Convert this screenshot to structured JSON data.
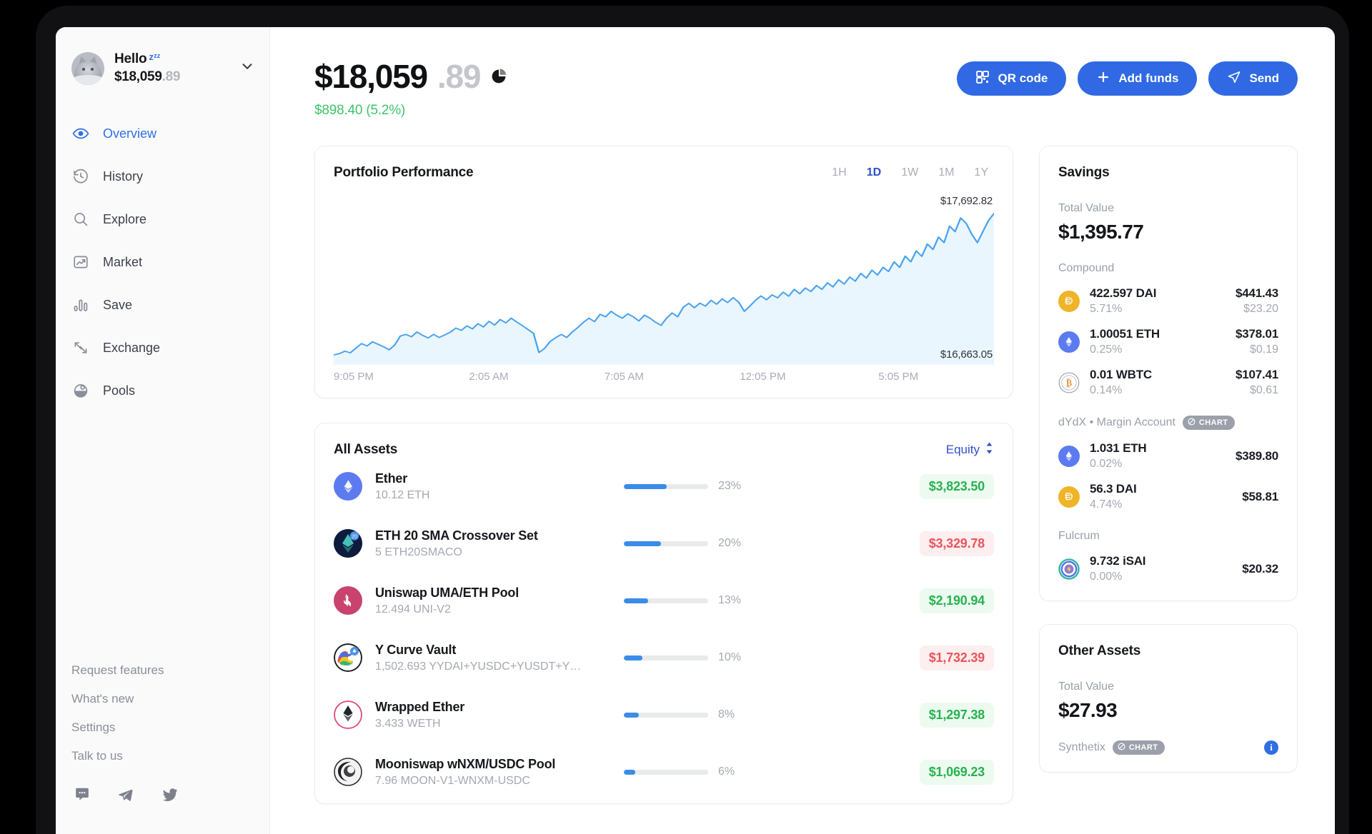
{
  "sidebar": {
    "greeting": "Hello",
    "sleep_emoji": "zᶻᶻ",
    "balance_main": "$18,059",
    "balance_cents": ".89",
    "nav": [
      {
        "label": "Overview",
        "icon": "eye-icon",
        "active": true
      },
      {
        "label": "History",
        "icon": "history-clock-icon",
        "active": false
      },
      {
        "label": "Explore",
        "icon": "search-icon",
        "active": false
      },
      {
        "label": "Market",
        "icon": "market-trend-icon",
        "active": false
      },
      {
        "label": "Save",
        "icon": "bar-chart-icon",
        "active": false
      },
      {
        "label": "Exchange",
        "icon": "exchange-arrows-icon",
        "active": false
      },
      {
        "label": "Pools",
        "icon": "pools-pie-icon",
        "active": false
      }
    ],
    "links": [
      "Request features",
      "What's new",
      "Settings",
      "Talk to us"
    ],
    "socials": [
      "discord-icon",
      "telegram-icon",
      "twitter-icon"
    ]
  },
  "header": {
    "balance_main": "$18,059",
    "balance_cents": ".89",
    "pie_icon": "pie-chart-icon",
    "change": "$898.40 (5.2%)",
    "change_color": "#3dc46a",
    "buttons": [
      {
        "label": "QR code",
        "icon": "qr-code-icon"
      },
      {
        "label": "Add funds",
        "icon": "plus-icon"
      },
      {
        "label": "Send",
        "icon": "send-paper-plane-icon"
      }
    ]
  },
  "chart_data": {
    "type": "area",
    "title": "Portfolio Performance",
    "xlabel": "",
    "ylabel": "",
    "ranges": [
      "1H",
      "1D",
      "1W",
      "1M",
      "1Y"
    ],
    "active_range": "1D",
    "high_label": "$17,692.82",
    "low_label": "$16,663.05",
    "ylim": [
      16663.05,
      17692.82
    ],
    "grid": false,
    "legend": "none",
    "line_color": "#4ba3ef",
    "fill_color": "#eaf5fd",
    "x_ticks": [
      "9:05 PM",
      "2:05 AM",
      "7:05 AM",
      "12:05 PM",
      "5:05 PM"
    ],
    "x": [
      0,
      1,
      2,
      3,
      4,
      5,
      6,
      7,
      8,
      9,
      10,
      11,
      12,
      13,
      14,
      15,
      16,
      17,
      18,
      19,
      20,
      21,
      22,
      23,
      24,
      25,
      26,
      27,
      28,
      29,
      30,
      31,
      32,
      33,
      34,
      35,
      36,
      37,
      38,
      39,
      40,
      41,
      42,
      43,
      44,
      45,
      46,
      47,
      48,
      49,
      50,
      51,
      52,
      53,
      54,
      55,
      56,
      57,
      58,
      59,
      60,
      61,
      62,
      63,
      64,
      65,
      66,
      67,
      68,
      69,
      70,
      71,
      72,
      73,
      74,
      75,
      76,
      77,
      78,
      79,
      80,
      81,
      82,
      83,
      84,
      85,
      86,
      87,
      88,
      89,
      90,
      91,
      92,
      93,
      94,
      95,
      96,
      97,
      98,
      99,
      100,
      101,
      102,
      103,
      104,
      105,
      106,
      107,
      108,
      109,
      110,
      111,
      112,
      113,
      114,
      115,
      116,
      117,
      118,
      119
    ],
    "values": [
      16663,
      16672,
      16690,
      16678,
      16712,
      16745,
      16728,
      16758,
      16740,
      16722,
      16700,
      16735,
      16800,
      16812,
      16795,
      16830,
      16806,
      16786,
      16812,
      16790,
      16808,
      16828,
      16858,
      16842,
      16874,
      16852,
      16890,
      16866,
      16908,
      16880,
      16920,
      16896,
      16930,
      16902,
      16876,
      16848,
      16820,
      16680,
      16710,
      16760,
      16788,
      16812,
      16790,
      16830,
      16862,
      16900,
      16930,
      16905,
      16958,
      16940,
      16980,
      16952,
      16930,
      16962,
      16940,
      16910,
      16952,
      16930,
      16900,
      16878,
      16930,
      16968,
      16940,
      17010,
      17038,
      17006,
      17040,
      17018,
      17060,
      17032,
      17070,
      17044,
      17080,
      17046,
      16980,
      17018,
      17060,
      17092,
      17064,
      17100,
      17078,
      17120,
      17090,
      17140,
      17108,
      17150,
      17124,
      17168,
      17140,
      17188,
      17158,
      17210,
      17178,
      17230,
      17200,
      17256,
      17222,
      17280,
      17244,
      17300,
      17270,
      17340,
      17300,
      17382,
      17340,
      17420,
      17380,
      17470,
      17430,
      17520,
      17480,
      17600,
      17560,
      17660,
      17620,
      17540,
      17480,
      17560,
      17640,
      17692
    ]
  },
  "assets": {
    "title": "All Assets",
    "sort_label": "Equity",
    "sort_icon": "sort-updown-icon",
    "rows": [
      {
        "name": "Ether",
        "sub": "10.12 ETH",
        "pct": "23%",
        "pct_num": 23,
        "value": "$3,823.50",
        "direction": "up",
        "icon": "eth-coin-icon"
      },
      {
        "name": "ETH 20 SMA Crossover Set",
        "sub": "5 ETH20SMACO",
        "pct": "20%",
        "pct_num": 20,
        "value": "$3,329.78",
        "direction": "down",
        "icon": "set-token-icon"
      },
      {
        "name": "Uniswap UMA/ETH Pool",
        "sub": "12.494 UNI-V2",
        "pct": "13%",
        "pct_num": 13,
        "value": "$2,190.94",
        "direction": "up",
        "icon": "uniswap-icon"
      },
      {
        "name": "Y Curve Vault",
        "sub": "1,502.693 YYDAI+YUSDC+YUSDT+Y…",
        "pct": "10%",
        "pct_num": 10,
        "value": "$1,732.39",
        "direction": "down",
        "icon": "curve-vault-icon"
      },
      {
        "name": "Wrapped Ether",
        "sub": "3.433 WETH",
        "pct": "8%",
        "pct_num": 8,
        "value": "$1,297.38",
        "direction": "up",
        "icon": "weth-icon"
      },
      {
        "name": "Mooniswap wNXM/USDC Pool",
        "sub": "7.96 MOON-V1-WNXM-USDC",
        "pct": "6%",
        "pct_num": 6,
        "value": "$1,069.23",
        "direction": "up",
        "icon": "mooniswap-icon"
      }
    ]
  },
  "savings": {
    "title": "Savings",
    "total_label": "Total Value",
    "total_value": "$1,395.77",
    "groups": [
      {
        "label": "Compound",
        "badge": null,
        "rows": [
          {
            "amount": "422.597 DAI",
            "apy": "5.71%",
            "value": "$441.43",
            "earned": "$23.20",
            "icon": "dai-coin-icon"
          },
          {
            "amount": "1.00051 ETH",
            "apy": "0.25%",
            "value": "$378.01",
            "earned": "$0.19",
            "icon": "eth-coin-icon"
          },
          {
            "amount": "0.01 WBTC",
            "apy": "0.14%",
            "value": "$107.41",
            "earned": "$0.61",
            "icon": "wbtc-coin-icon"
          }
        ]
      },
      {
        "label": "dYdX • Margin Account",
        "badge": "CHART",
        "rows": [
          {
            "amount": "1.031 ETH",
            "apy": "0.02%",
            "value": "$389.80",
            "earned": "",
            "icon": "eth-coin-icon"
          },
          {
            "amount": "56.3 DAI",
            "apy": "4.74%",
            "value": "$58.81",
            "earned": "",
            "icon": "dai-coin-icon"
          }
        ]
      },
      {
        "label": "Fulcrum",
        "badge": null,
        "rows": [
          {
            "amount": "9.732 iSAI",
            "apy": "0.00%",
            "value": "$20.32",
            "earned": "",
            "icon": "fulcrum-isai-icon"
          }
        ]
      }
    ]
  },
  "other_assets": {
    "title": "Other Assets",
    "total_label": "Total Value",
    "total_value": "$27.93",
    "provider": "Synthetix",
    "badge": "CHART",
    "info_icon": "info-icon"
  }
}
